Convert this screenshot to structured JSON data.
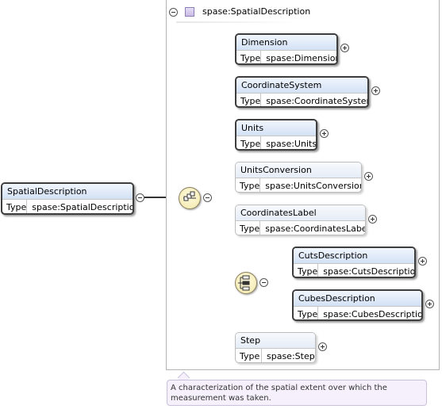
{
  "root": {
    "name": "SpatialDescription",
    "type_label": "Type",
    "type_value": "spase:SpatialDescription"
  },
  "complex_type": {
    "name": "spase:SpatialDescription"
  },
  "sequence_children": [
    {
      "name": "Dimension",
      "type_label": "Type",
      "type_value": "spase:Dimension",
      "required": true
    },
    {
      "name": "CoordinateSystem",
      "type_label": "Type",
      "type_value": "spase:CoordinateSystem",
      "required": true
    },
    {
      "name": "Units",
      "type_label": "Type",
      "type_value": "spase:Units",
      "required": true
    },
    {
      "name": "UnitsConversion",
      "type_label": "Type",
      "type_value": "spase:UnitsConversion",
      "required": false
    },
    {
      "name": "CoordinatesLabel",
      "type_label": "Type",
      "type_value": "spase:CoordinatesLabel",
      "required": false
    },
    {
      "name": "Step",
      "type_label": "Type",
      "type_value": "spase:Step",
      "required": false
    }
  ],
  "choice_children": [
    {
      "name": "CutsDescription",
      "type_label": "Type",
      "type_value": "spase:CutsDescription",
      "required": true
    },
    {
      "name": "CubesDescription",
      "type_label": "Type",
      "type_value": "spase:CubesDescription",
      "required": true
    }
  ],
  "documentation": "A characterization of the spatial extent over which the measurement was taken."
}
